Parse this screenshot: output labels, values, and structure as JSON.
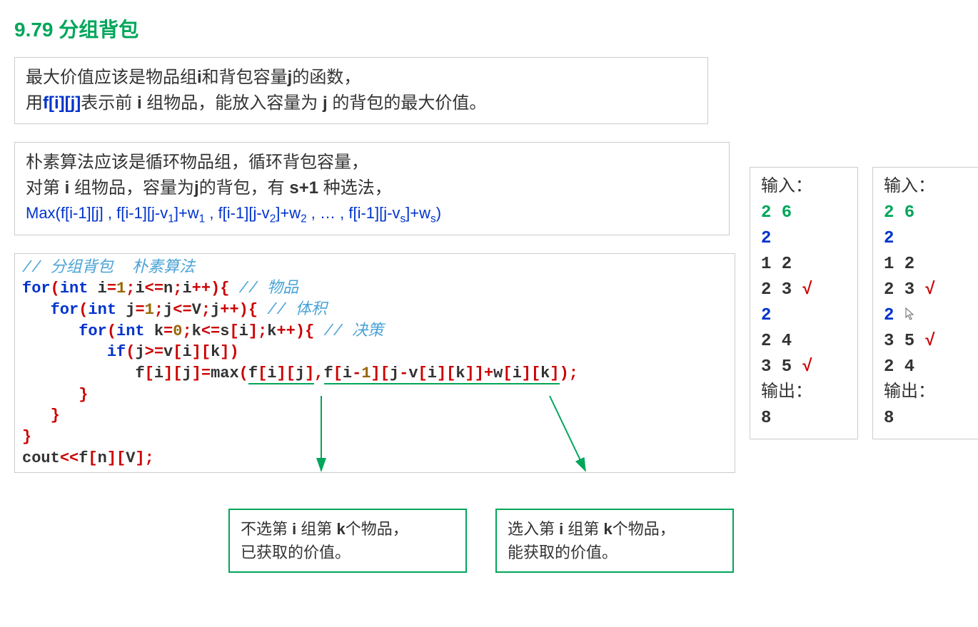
{
  "heading": {
    "num": "9.79",
    "title": "分组背包"
  },
  "box1": {
    "line1_a": "最大价值应该是物品组",
    "line1_b": "i",
    "line1_c": "和背包容量",
    "line1_d": "j",
    "line1_e": "的函数，",
    "line2_a": "用",
    "line2_fij": "f[i][j]",
    "line2_b": "表示前 ",
    "line2_i": "i",
    "line2_c": " 组物品，能放入容量为 ",
    "line2_j": "j",
    "line2_d": " 的背包的最大价值。"
  },
  "box2": {
    "line1": "朴素算法应该是循环物品组，循环背包容量，",
    "line2_a": "对第 ",
    "line2_i": "i",
    "line2_b": " 组物品，容量为",
    "line2_j": "j",
    "line2_c": "的背包，有 ",
    "line2_s1": "s+1",
    "line2_d": " 种选法，",
    "formula": "Max(f[i-1][j] , f[i-1][j-v₁]+w₁ , f[i-1][j-v₂]+w₂ , ... , f[i-1][j-vₛ]+wₛ)"
  },
  "code": {
    "c1": "// 分组背包  朴素算法",
    "c2a": "for",
    "c2b": "int",
    "c2c": "i",
    "c2d": "1",
    "c2e": "i",
    "c2f": "n",
    "c2g": "i",
    "c2cmt": "// 物品",
    "c3a": "for",
    "c3b": "int",
    "c3c": "j",
    "c3d": "1",
    "c3e": "j",
    "c3f": "V",
    "c3g": "j",
    "c3cmt": "// 体积",
    "c4a": "for",
    "c4b": "int",
    "c4c": "k",
    "c4d": "0",
    "c4e": "k",
    "c4f": "s",
    "c4g": "i",
    "c4h": "k",
    "c4cmt": "// 决策",
    "c5a": "if",
    "c5b": "j",
    "c5c": "v",
    "c5d": "i",
    "c5e": "k",
    "c6a": "f",
    "c6b": "i",
    "c6c": "j",
    "c6d": "max",
    "c6e": "f",
    "c6f": "i",
    "c6g": "j",
    "c6h": "f",
    "c6i": "i",
    "c6j": "1",
    "c6k": "j",
    "c6l": "v",
    "c6m": "i",
    "c6n": "k",
    "c6o": "w",
    "c6p": "i",
    "c6q": "k",
    "c9a": "cout",
    "c9b": "f",
    "c9c": "n",
    "c9d": "V"
  },
  "callout1": {
    "l1": "不选第 i 组第 k个物品，",
    "l1_i": "i",
    "l1_k": "k",
    "l2": "已获取的价值。"
  },
  "callout2": {
    "l1": "选入第 i 组第 k个物品，",
    "l1_i": "i",
    "l1_k": "k",
    "l2": "能获取的价值。"
  },
  "io1": {
    "label_in": "输入：",
    "r1": "2 6",
    "r2": "2",
    "r3": "1 2",
    "r4": "2 3",
    "r5": "2",
    "r6": "2 4",
    "r7": "3 5",
    "label_out": "输出：",
    "out": "8",
    "check": "√"
  },
  "io2": {
    "label_in": "输入：",
    "r1": "2 6",
    "r2": "2",
    "r3": "1 2",
    "r4": "2 3",
    "r5": "2",
    "r6": "3 5",
    "r7": "2 4",
    "label_out": "输出：",
    "out": "8",
    "check": "√"
  }
}
